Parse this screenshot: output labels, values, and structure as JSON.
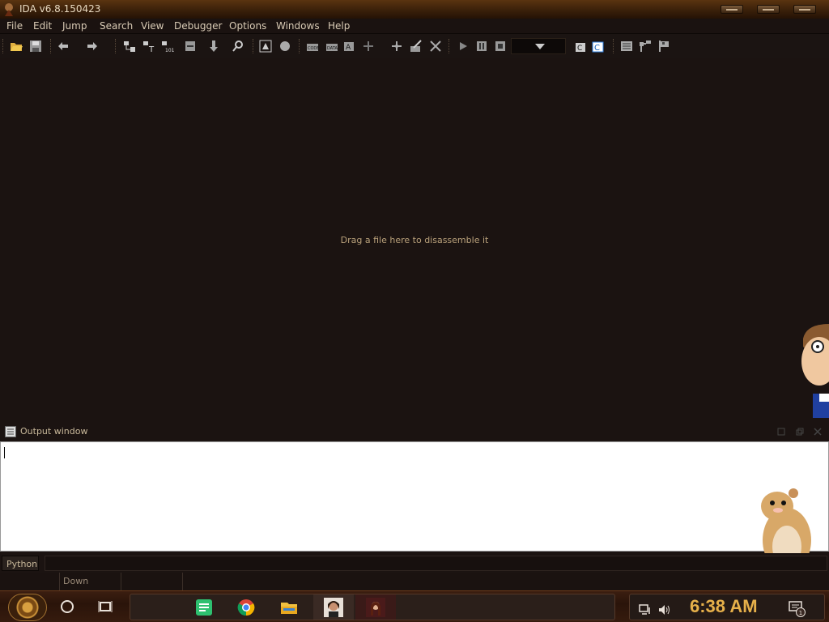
{
  "window": {
    "title": "IDA v6.8.150423"
  },
  "menu": {
    "items": [
      "File",
      "Edit",
      "Jump",
      "Search",
      "View",
      "Debugger",
      "Options",
      "Windows",
      "Help"
    ]
  },
  "main": {
    "hint": "Drag a file here to disassemble it"
  },
  "output": {
    "title": "Output window"
  },
  "python": {
    "label": "Python"
  },
  "status": {
    "direction": "Down"
  },
  "taskbar": {
    "clock": "6:38 AM",
    "notification_count": "1"
  },
  "colors": {
    "accent": "#e6b04a",
    "background": "#1b1311",
    "hint_text": "#b8a07a"
  },
  "toolbar": {
    "icons": [
      "open-icon",
      "save-icon",
      "back-icon",
      "forward-icon",
      "graph-icon",
      "text-icon",
      "hex-icon",
      "cross-ref-icon",
      "jump-icon",
      "search-icon",
      "image-icon",
      "circle-icon",
      "code-icon",
      "data-icon",
      "string-icon",
      "plus-icon",
      "struct-icon",
      "edit-icon",
      "delete-icon",
      "play-icon",
      "pause-icon",
      "stop-icon",
      "debugger-select",
      "plugin-icon",
      "c-icon",
      "list-icon",
      "tree-icon",
      "flag-icon"
    ]
  }
}
